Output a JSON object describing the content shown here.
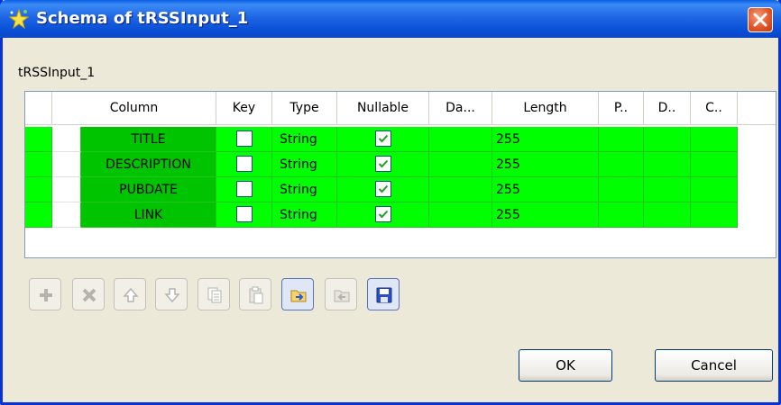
{
  "window": {
    "title": "Schema of tRSSInput_1"
  },
  "tab": {
    "label": "tRSSInput_1"
  },
  "table": {
    "headers": [
      "Column",
      "Key",
      "Type",
      "Nullable",
      "Da...",
      "Length",
      "P..",
      "D..",
      "C.."
    ],
    "rows": [
      {
        "column": "TITLE",
        "key": false,
        "type": "String",
        "nullable": true,
        "length": "255"
      },
      {
        "column": "DESCRIPTION",
        "key": false,
        "type": "String",
        "nullable": true,
        "length": "255"
      },
      {
        "column": "PUBDATE",
        "key": false,
        "type": "String",
        "nullable": true,
        "length": "255"
      },
      {
        "column": "LINK",
        "key": false,
        "type": "String",
        "nullable": true,
        "length": "255"
      }
    ]
  },
  "toolbar": {
    "icons": [
      "add-icon",
      "delete-icon",
      "move-up-icon",
      "move-down-icon",
      "copy-icon",
      "paste-icon",
      "import-schema-icon",
      "export-schema-icon",
      "save-icon"
    ]
  },
  "buttons": {
    "ok": "OK",
    "cancel": "Cancel"
  },
  "colors": {
    "row_green": "#00ff00",
    "name_green": "#00c400",
    "titlebar_blue": "#0a5ee6"
  }
}
